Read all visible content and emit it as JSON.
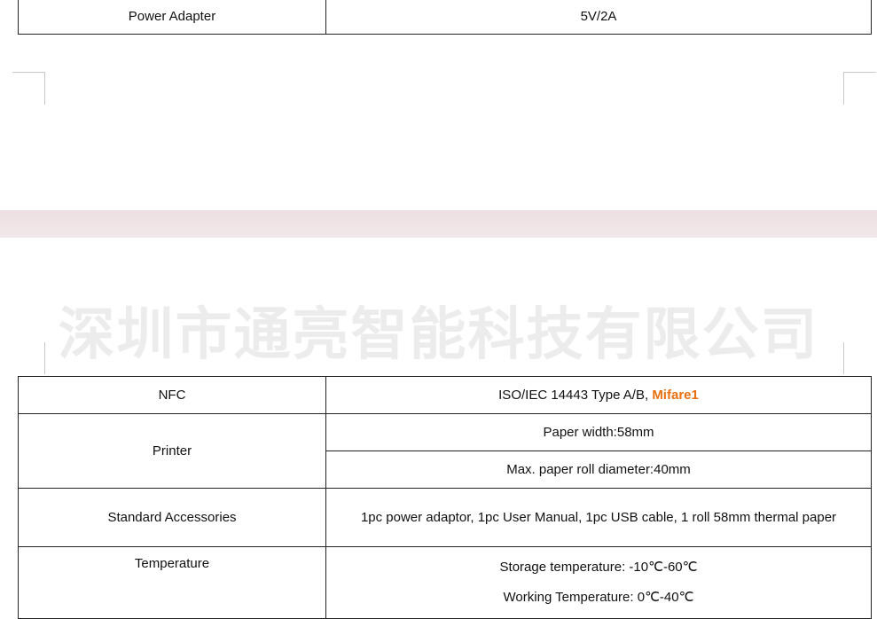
{
  "top_table": {
    "rows": [
      {
        "label": "Power Adapter",
        "value": "5V/2A"
      }
    ]
  },
  "divider": {
    "color": "#eedfe3"
  },
  "watermark": {
    "text": "深圳市通亮智能科技有限公司"
  },
  "specs": {
    "nfc": {
      "label": "NFC",
      "value": "ISO/IEC 14443 Type A/B, ",
      "highlight": "Mifare1",
      "highlight_color": "#e8700f"
    },
    "printer": {
      "label": "Printer",
      "values": [
        "Paper width:58mm",
        "Max. paper roll diameter:40mm"
      ]
    },
    "accessories": {
      "label": "Standard Accessories",
      "value": "1pc power adaptor, 1pc User Manual, 1pc USB cable, 1 roll 58mm thermal paper"
    },
    "temperature": {
      "label": "Temperature",
      "values": [
        "Storage temperature: -10℃-60℃",
        "Working Temperature: 0℃-40℃"
      ]
    }
  }
}
